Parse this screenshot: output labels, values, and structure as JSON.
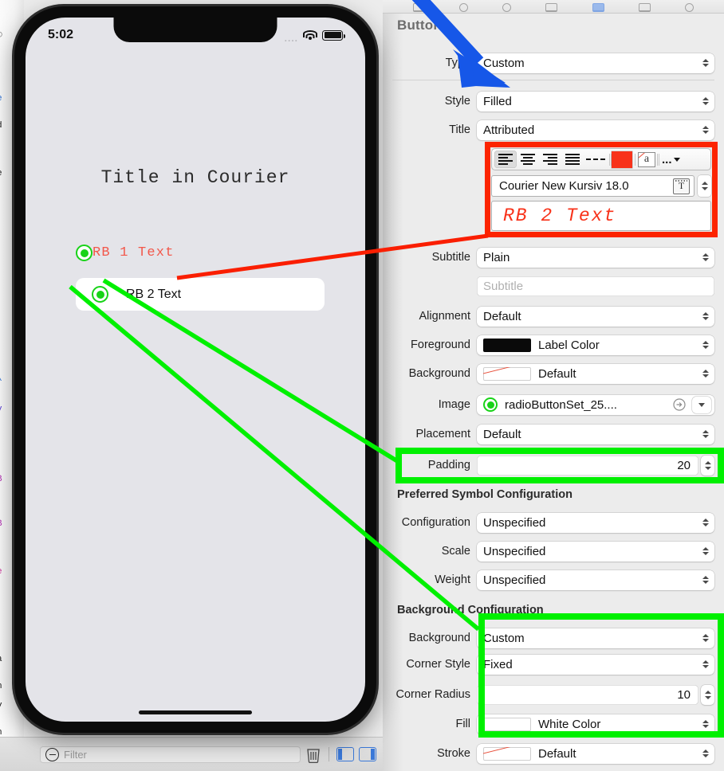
{
  "device": {
    "status_bar": {
      "time": "5:02",
      "signal_dots": "....",
      "wifi_icon": "wifi-icon",
      "battery_icon": "battery-icon"
    },
    "app": {
      "title": "Title in Courier",
      "radio_button_1": {
        "label": "RB 1 Text",
        "icon": "radio-button-selected-icon",
        "color": "#f2574a"
      },
      "radio_button_2": {
        "label": "RB 2 Text",
        "icon": "radio-button-selected-icon",
        "color": "#111111"
      }
    }
  },
  "filter_bar": {
    "placeholder": "Filter",
    "filter_icon": "filter-icon",
    "trash_icon": "trash-icon",
    "left_panel_icon": "left-panel-icon",
    "right_panel_icon": "right-panel-icon"
  },
  "inspector": {
    "title": "Button",
    "rows": {
      "type": {
        "label": "Type",
        "value": "Custom"
      },
      "style": {
        "label": "Style",
        "value": "Filled"
      },
      "title": {
        "label": "Title",
        "value": "Attributed"
      },
      "subtitle": {
        "label": "Subtitle",
        "value": "Plain"
      },
      "subtitle_text": {
        "placeholder": "Subtitle",
        "value": ""
      },
      "alignment": {
        "label": "Alignment",
        "value": "Default"
      },
      "foreground": {
        "label": "Foreground",
        "value": "Label Color",
        "swatch": "#0a0a0a"
      },
      "background": {
        "label": "Background",
        "value": "Default",
        "swatch": "none"
      },
      "image": {
        "label": "Image",
        "value": "radioButtonSet_25....",
        "icon": "radio-button-selected-icon"
      },
      "placement": {
        "label": "Placement",
        "value": "Default"
      },
      "padding": {
        "label": "Padding",
        "value": "20"
      },
      "configuration": {
        "label": "Configuration",
        "value": "Unspecified"
      },
      "scale": {
        "label": "Scale",
        "value": "Unspecified"
      },
      "weight": {
        "label": "Weight",
        "value": "Unspecified"
      },
      "bg_custom": {
        "label": "Background",
        "value": "Custom"
      },
      "corner_style": {
        "label": "Corner Style",
        "value": "Fixed"
      },
      "corner_radius": {
        "label": "Corner Radius",
        "value": "10"
      },
      "fill": {
        "label": "Fill",
        "value": "White Color",
        "swatch": "#ffffff"
      },
      "stroke": {
        "label": "Stroke",
        "value": "Default",
        "swatch": "none"
      }
    },
    "sections": {
      "symbol_config": "Preferred Symbol Configuration",
      "background_config": "Background Configuration"
    }
  },
  "attributed_editor": {
    "toolbar": {
      "align_left_icon": "align-left-icon",
      "align_center_icon": "align-center-icon",
      "align_right_icon": "align-right-icon",
      "align_justify_icon": "align-justify-icon",
      "line_spacing_icon": "line-spacing-icon",
      "text_color_swatch": "#f8321a",
      "no_color_icon": "no-color-icon",
      "more_label": "..."
    },
    "font": {
      "value": "Courier New Kursiv 18.0",
      "text_options_icon": "text-options-icon"
    },
    "preview_text": "RB 2 Text",
    "preview_color": "#f8321a"
  },
  "annotations": {
    "blue_arrow_color": "#1657e8",
    "red_highlight_color": "#fc2400",
    "green_highlight_color": "#00f000",
    "red_line_color": "#fa1e00",
    "green_line_color": "#00f000"
  }
}
